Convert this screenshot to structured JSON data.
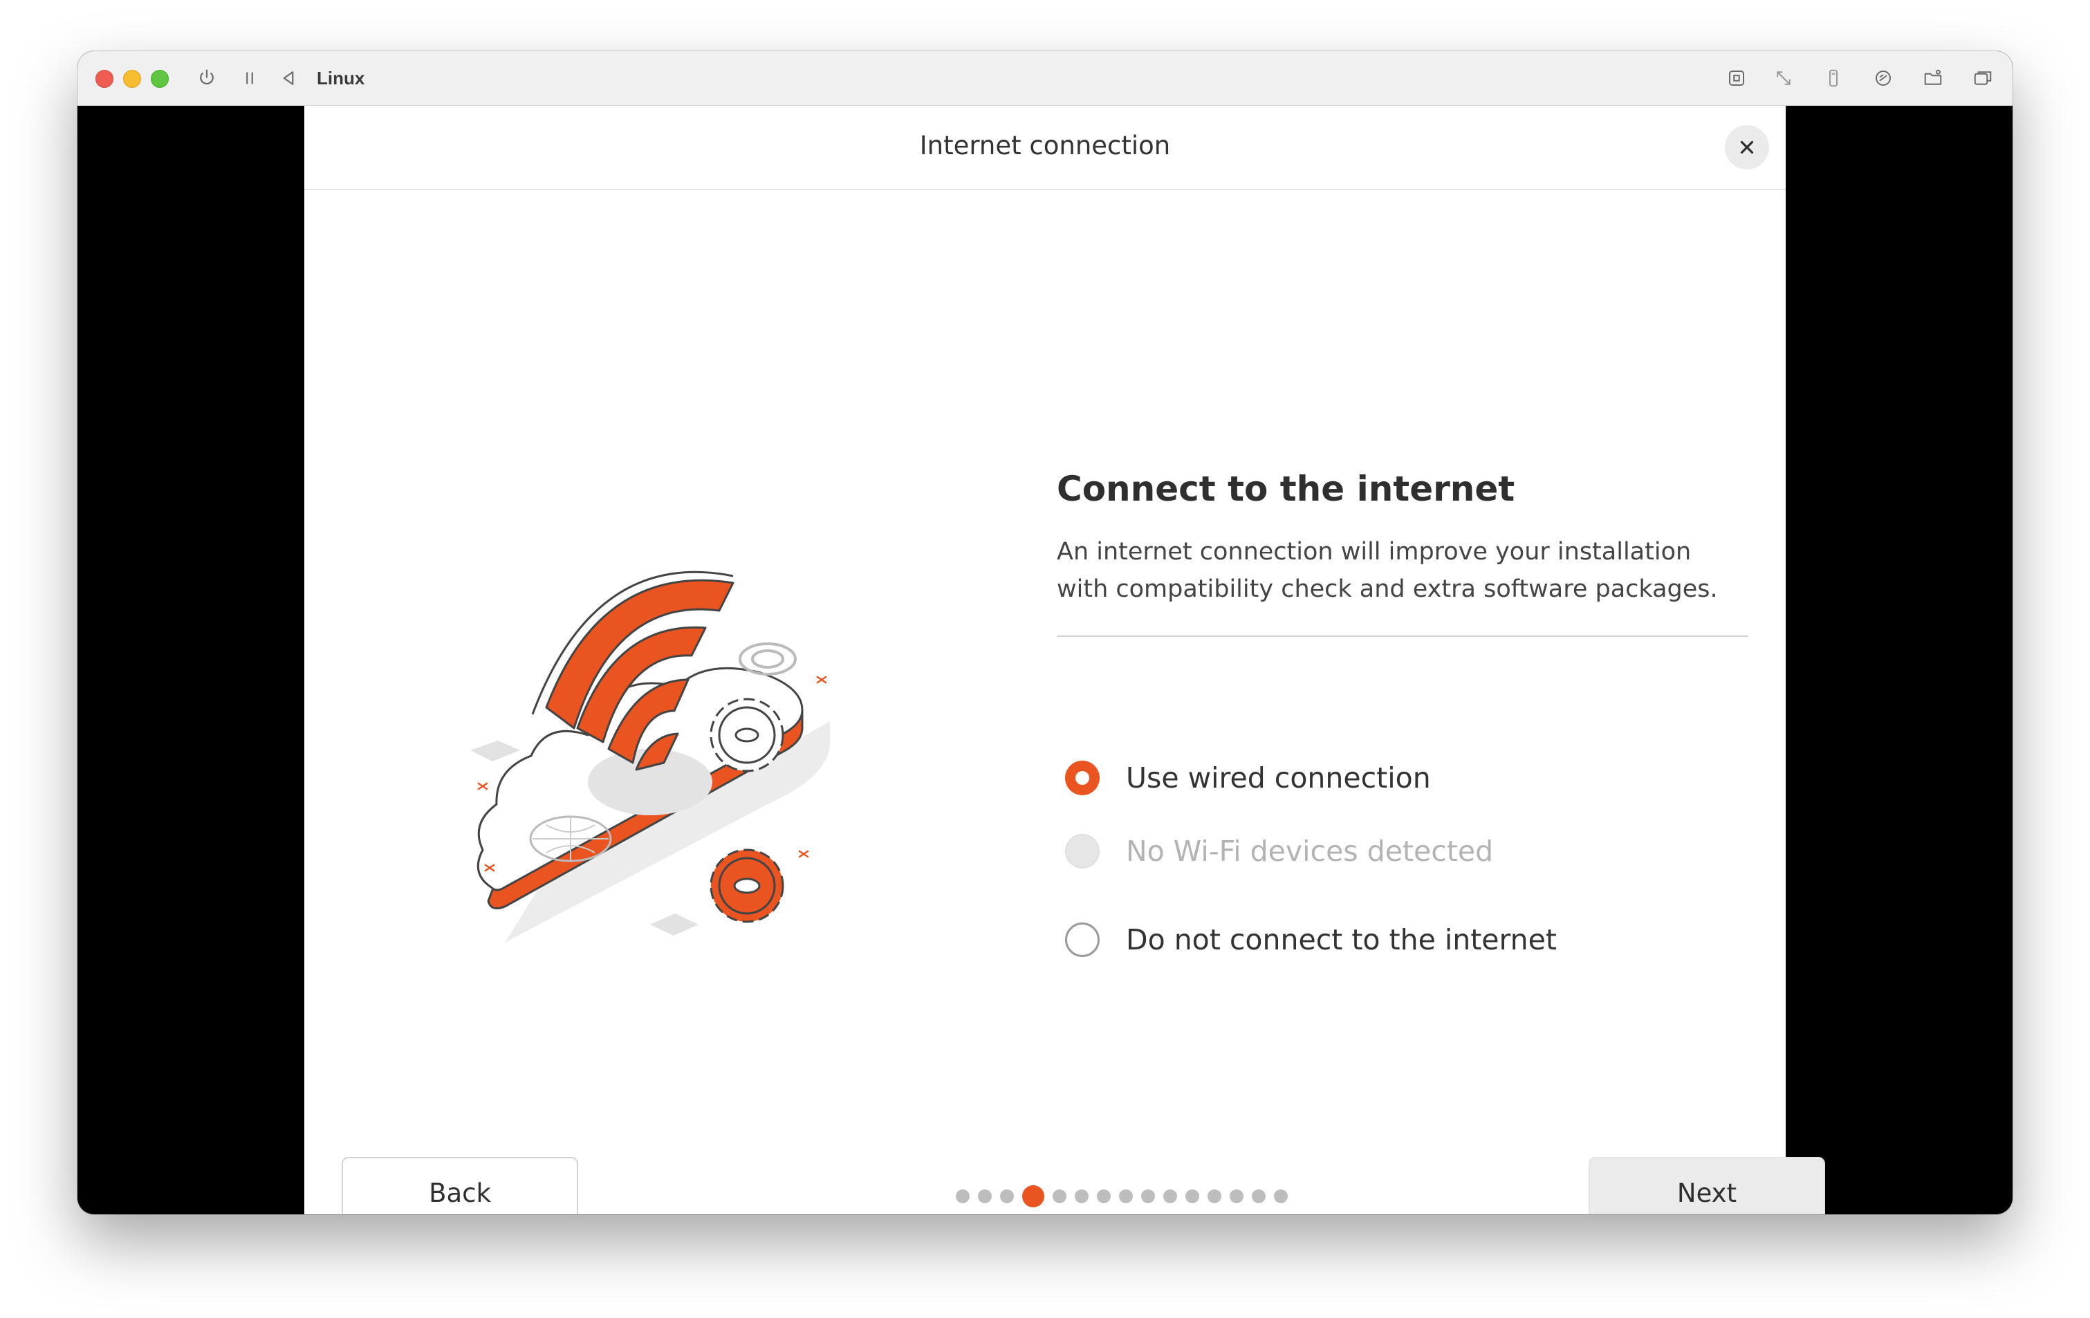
{
  "vm": {
    "title": "Linux",
    "toolbar_icons": [
      "power-icon",
      "pause-icon",
      "back-arrow-icon"
    ],
    "right_icons": [
      "keyboard-command-icon",
      "resize-arrows-icon",
      "usb-icon",
      "network-icon",
      "shared-folder-icon",
      "window-icon"
    ]
  },
  "dialog": {
    "title": "Internet connection",
    "close_icon": "close-icon"
  },
  "content": {
    "heading": "Connect to the internet",
    "description": "An internet connection will improve your installation with compatibility check and extra software packages.",
    "options": [
      {
        "label": "Use wired connection",
        "state": "checked"
      },
      {
        "label": "No Wi-Fi devices detected",
        "state": "disabled"
      },
      {
        "label": "Do not connect to the internet",
        "state": "unchecked"
      }
    ]
  },
  "footer": {
    "back_label": "Back",
    "next_label": "Next",
    "pager_total": 15,
    "pager_current": 4
  },
  "colors": {
    "accent": "#e95420",
    "dot_inactive": "#bdbdbd"
  }
}
